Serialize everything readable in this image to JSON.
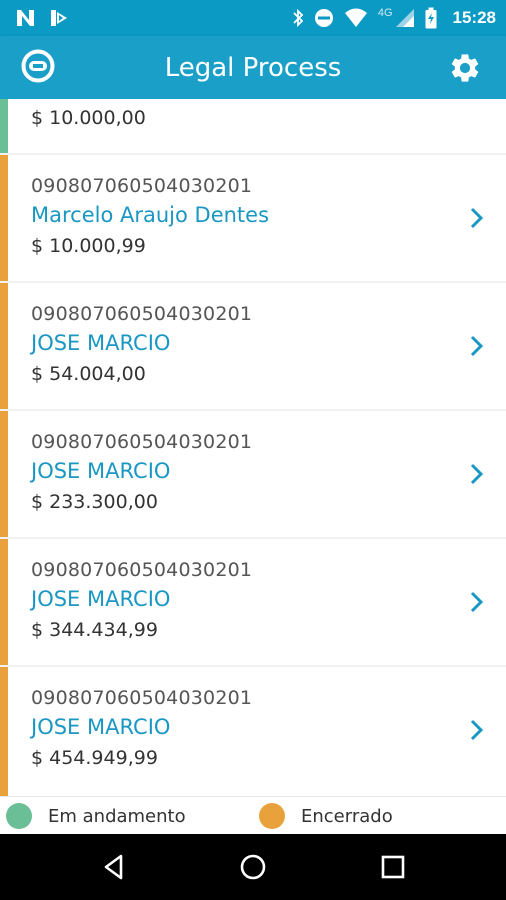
{
  "status_bar": {
    "time": "15:28",
    "network": "4G",
    "icons": [
      "n-notification-icon",
      "play-notification-icon",
      "bluetooth-icon",
      "do-not-disturb-icon",
      "wifi-icon",
      "signal-icon",
      "battery-icon"
    ]
  },
  "app_bar": {
    "title": "Legal Process",
    "logo_icon": "app-logo-icon",
    "settings_icon": "gear-icon"
  },
  "processes": [
    {
      "code": "",
      "name": "",
      "amount": "$ 10.000,00",
      "status": "em_andamento"
    },
    {
      "code": "090807060504030201",
      "name": "Marcelo Araujo Dentes",
      "amount": "$ 10.000,99",
      "status": "encerrado"
    },
    {
      "code": "090807060504030201",
      "name": "JOSE MARCIO",
      "amount": "$ 54.004,00",
      "status": "encerrado"
    },
    {
      "code": "090807060504030201",
      "name": "JOSE MARCIO",
      "amount": "$ 233.300,00",
      "status": "encerrado"
    },
    {
      "code": "090807060504030201",
      "name": "JOSE MARCIO",
      "amount": "$ 344.434,99",
      "status": "encerrado"
    },
    {
      "code": "090807060504030201",
      "name": "JOSE MARCIO",
      "amount": "$ 454.949,99",
      "status": "encerrado"
    }
  ],
  "legend": {
    "in_progress": {
      "label": "Em andamento",
      "color": "#6bbf96"
    },
    "closed": {
      "label": "Encerrado",
      "color": "#e9a23b"
    }
  },
  "colors": {
    "status_bar": "#0b9ac4",
    "app_bar": "#1aa0c8",
    "accent": "#1a97c2"
  },
  "nav_bar": {
    "icons": [
      "back-icon",
      "home-icon",
      "recents-icon"
    ]
  }
}
